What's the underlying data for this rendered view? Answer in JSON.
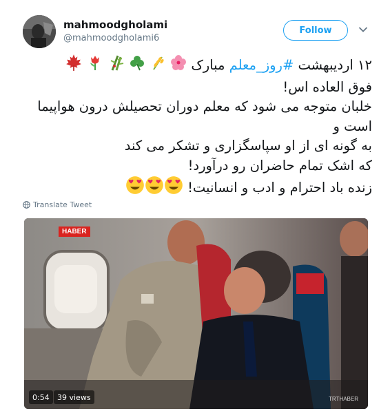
{
  "user": {
    "name": "mahmoodgholami",
    "handle": "@mahmoodgholami6"
  },
  "follow_label": "Follow",
  "tweet": {
    "line1_prefix": "۱۲ اردیبهشت",
    "hashtag": "#روز_معلم",
    "line1_suffix": "مبارک",
    "line2": "فوق العاده اس!",
    "line3": "خلبان متوجه می شود که معلم دوران تحصیلش درون هواپیما",
    "line4": "است و",
    "line5": "به گونه ای از او سپاسگزاری و تشکر می کند",
    "line6": "که اشک تمام حاضران رو درآورد!",
    "line7": "زنده باد احترام و ادب و انسانیت!"
  },
  "translate_label": "Translate Tweet",
  "video": {
    "duration": "0:54",
    "views": "39 views",
    "logo_text": "HABER",
    "watermark": "TRTHABER"
  },
  "icons": {
    "line1_emojis": [
      "hibiscus-icon",
      "wheat-icon",
      "shamrock-icon",
      "bamboo-icon",
      "tulip-icon",
      "maple-leaf-icon"
    ],
    "line7_emojis": [
      "heart-eyes-icon",
      "heart-eyes-icon",
      "heart-eyes-icon"
    ],
    "chevron": "chevron-down-icon",
    "globe": "globe-icon"
  }
}
